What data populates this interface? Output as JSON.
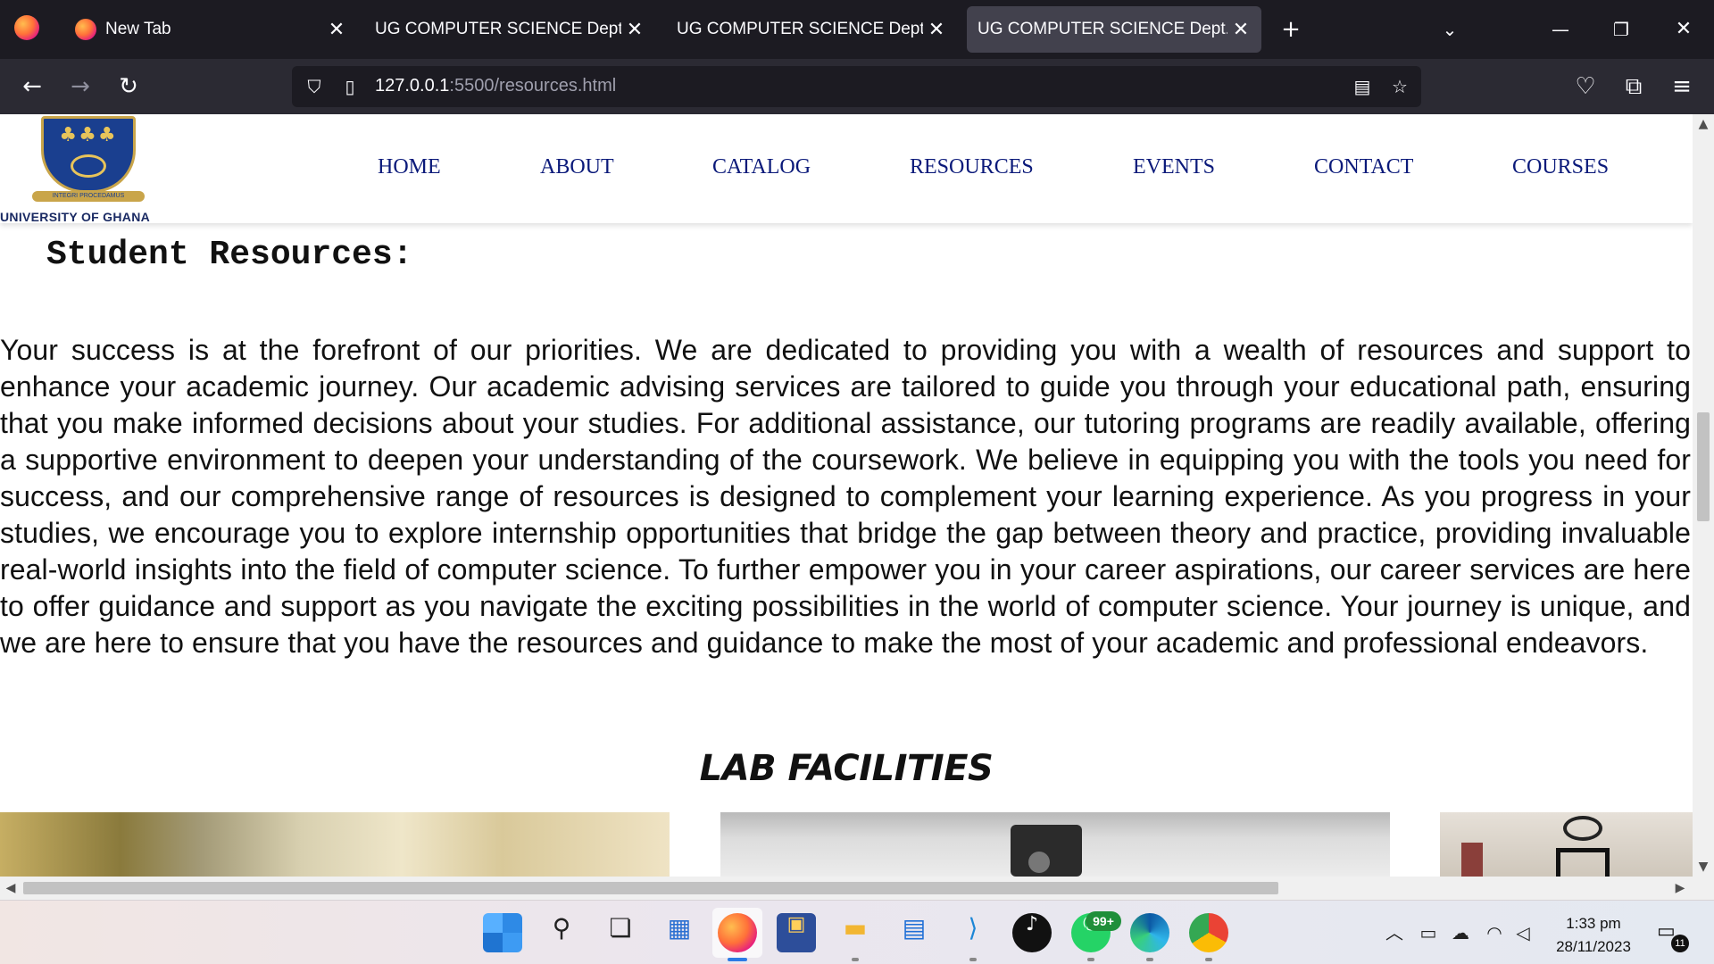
{
  "browser": {
    "tabs": [
      {
        "title": "New Tab",
        "active": false,
        "has_favicon": true
      },
      {
        "title": "UG COMPUTER SCIENCE Dept.",
        "active": false,
        "has_favicon": false
      },
      {
        "title": "UG COMPUTER SCIENCE Dept.",
        "active": false,
        "has_favicon": false
      },
      {
        "title": "UG COMPUTER SCIENCE Dept.",
        "active": true,
        "has_favicon": false
      }
    ],
    "url_host": "127.0.0.1",
    "url_path": ":5500/resources.html",
    "icons": {
      "back": "arrow-left-icon",
      "forward": "arrow-right-icon",
      "reload": "reload-icon",
      "shield": "shield-icon",
      "page": "page-icon",
      "reader": "reader-view-icon",
      "bookmark": "star-icon",
      "pocket": "pocket-icon",
      "extensions": "puzzle-icon",
      "menu": "hamburger-menu-icon"
    }
  },
  "site": {
    "logo_caption": "UNIVERSITY OF GHANA",
    "logo_motto": "INTEGRI PROCEDAMUS",
    "menu": [
      "HOME",
      "ABOUT",
      "CATALOG",
      "RESOURCES",
      "EVENTS",
      "CONTACT",
      "COURSES"
    ],
    "page_title": "Student Resources:",
    "paragraph": "Your success is at the forefront of our priorities. We are dedicated to providing you with a wealth of resources and support to enhance your academic journey. Our academic advising services are tailored to guide you through your educational path, ensuring that you make informed decisions about your studies. For additional assistance, our tutoring programs are readily available, offering a supportive environment to deepen your understanding of the coursework. We believe in equipping you with the tools you need for success, and our comprehensive range of resources is designed to complement your learning experience. As you progress in your studies, we encourage you to explore internship opportunities that bridge the gap between theory and practice, providing invaluable real-world insights into the field of computer science. To further empower you in your career aspirations, our career services are here to offer guidance and support as you navigate the exciting possibilities in the world of computer science. Your journey is unique, and we are here to ensure that you have the resources and guidance to make the most of your academic and professional endeavors.",
    "lab_heading": "LAB FACILITIES",
    "colors": {
      "menu_link": "#0b1a7a",
      "text": "#111111"
    }
  },
  "taskbar": {
    "apps": [
      "windows-start-icon",
      "search-icon",
      "task-view-icon",
      "widgets-icon",
      "firefox-icon",
      "photos-icon",
      "file-explorer-icon",
      "microsoft-store-icon",
      "vscode-icon",
      "tiktok-icon",
      "whatsapp-icon",
      "edge-icon",
      "chrome-icon"
    ],
    "whatsapp_badge": "99+",
    "time": "1:33 pm",
    "date": "28/11/2023",
    "notification_count": "11"
  }
}
